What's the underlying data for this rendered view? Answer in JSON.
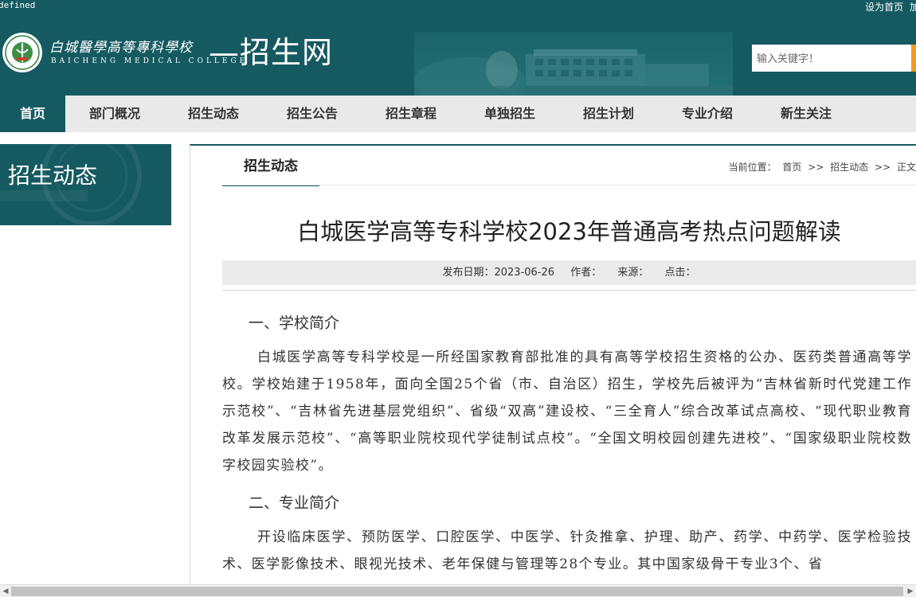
{
  "top": {
    "debug_text": "defined",
    "links": [
      "设为首页",
      "加"
    ]
  },
  "logo": {
    "cn_name": "白城醫學高等專科學校",
    "en_name": "BAICHENG MEDICAL COLLEGE",
    "site_suffix": "—招生网"
  },
  "search": {
    "placeholder": "输入关键字！"
  },
  "nav": {
    "items": [
      {
        "label": "首页",
        "active": true
      },
      {
        "label": "部门概况"
      },
      {
        "label": "招生动态"
      },
      {
        "label": "招生公告"
      },
      {
        "label": "招生章程"
      },
      {
        "label": "单独招生"
      },
      {
        "label": "招生计划"
      },
      {
        "label": "专业介绍"
      },
      {
        "label": "新生关注"
      }
    ]
  },
  "sidebar": {
    "title": "招生动态"
  },
  "section": {
    "tab_label": "招生动态",
    "breadcrumb": {
      "prefix": "当前位置：",
      "items": [
        "首页",
        "招生动态",
        "正文"
      ],
      "separator": ">>"
    }
  },
  "article": {
    "title": "白城医学高等专科学校2023年普通高考热点问题解读",
    "meta": {
      "date_label": "发布日期：",
      "date": "2023-06-26",
      "author_label": "作者：",
      "source_label": "来源：",
      "clicks_label": "点击："
    },
    "sections": [
      {
        "heading": "一、学校简介",
        "paragraph": "白城医学高等专科学校是一所经国家教育部批准的具有高等学校招生资格的公办、医药类普通高等学校。学校始建于1958年，面向全国25个省（市、自治区）招生，学校先后被评为“吉林省新时代党建工作示范校”、“吉林省先进基层党组织”、省级“双高”建设校、“三全育人”综合改革试点高校、“现代职业教育改革发展示范校”、“高等职业院校现代学徒制试点校”。“全国文明校园创建先进校”、“国家级职业院校数字校园实验校”。"
      },
      {
        "heading": "二、专业简介",
        "paragraph": "开设临床医学、预防医学、口腔医学、中医学、针灸推拿、护理、助产、药学、中药学、医学检验技术、医学影像技术、眼视光技术、老年保健与管理等28个专业。其中国家级骨干专业3个、省"
      }
    ]
  },
  "colors": {
    "brand": "#165a61",
    "nav_bg": "#e9e9e9",
    "search_accent": "#f39a1f"
  }
}
